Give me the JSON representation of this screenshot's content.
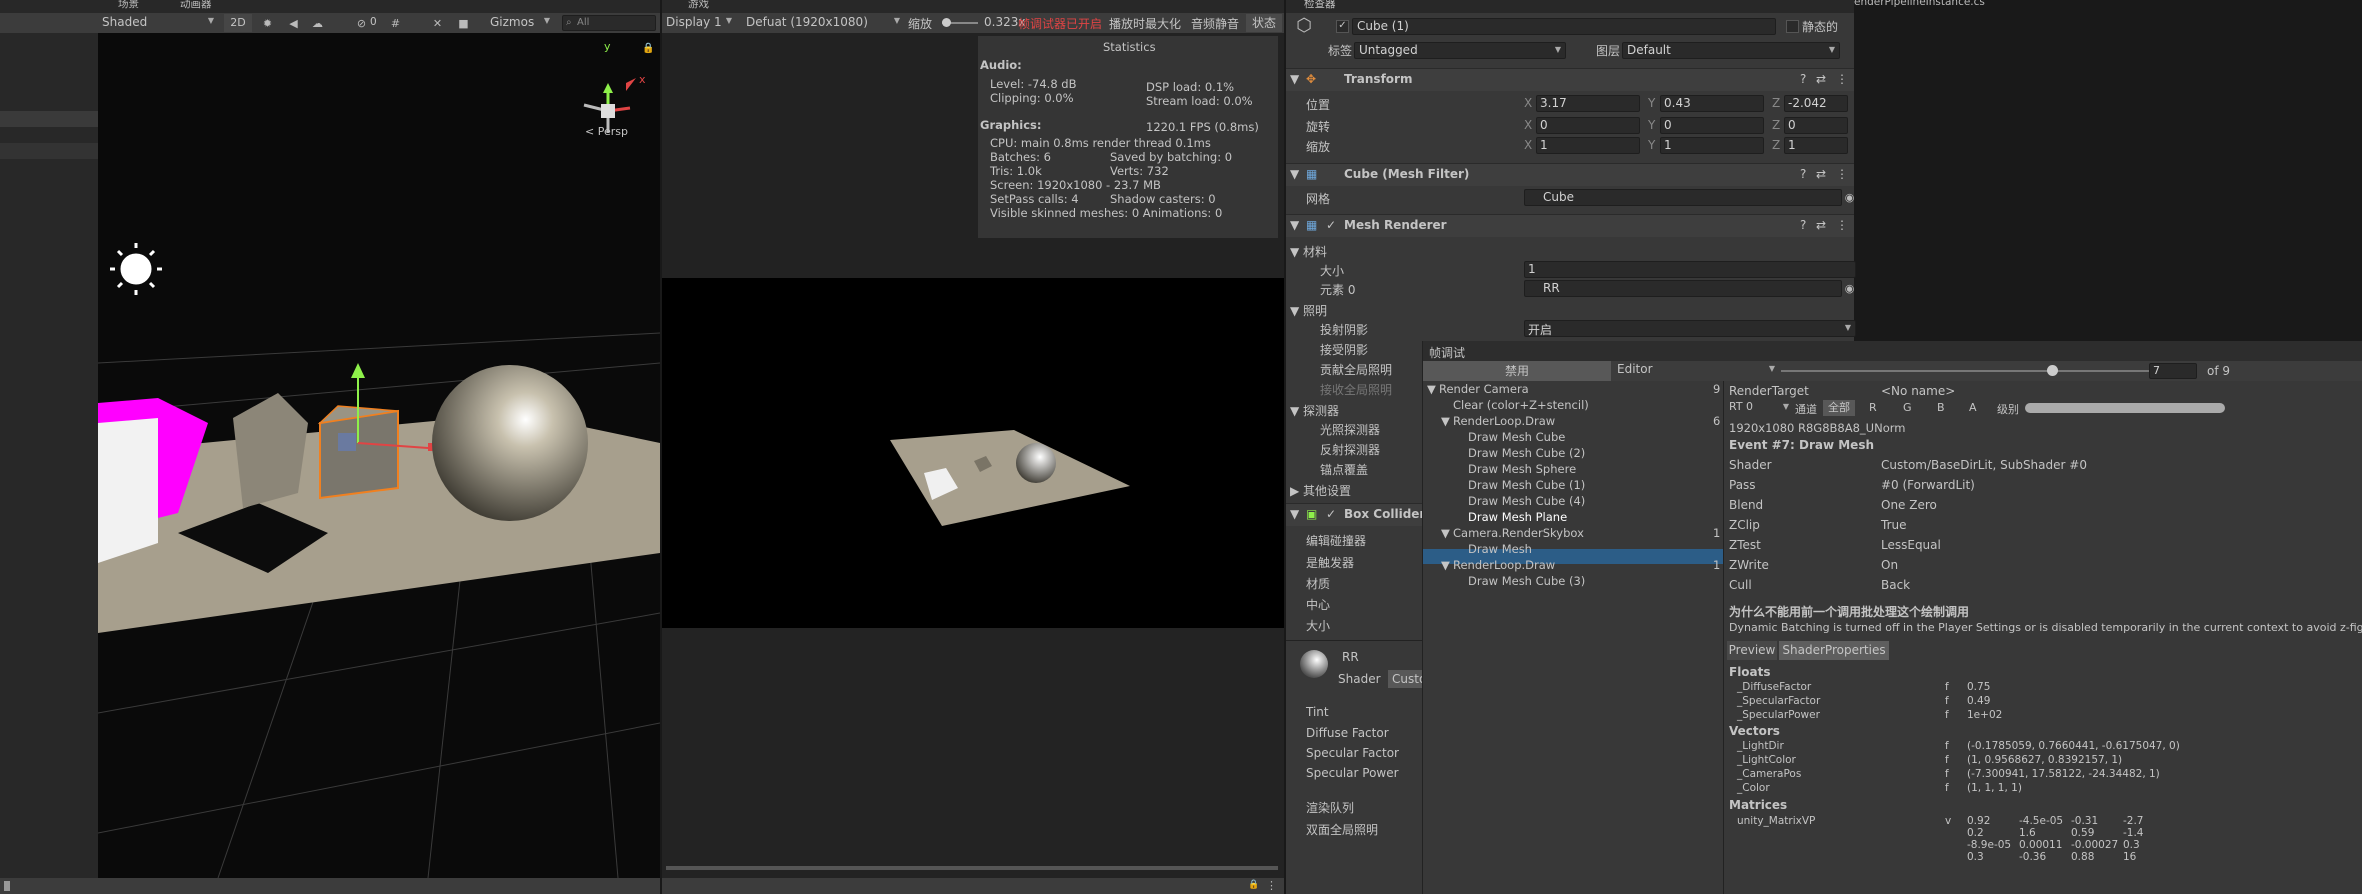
{
  "scene": {
    "tab": "场景",
    "tab2": "动画器",
    "shading": "Shaded",
    "mode2d": "2D",
    "fx_count": "0",
    "gizmos": "Gizmos",
    "search_placeholder": "All",
    "persp": "< Persp",
    "axis_x": "x",
    "axis_y": "y"
  },
  "game": {
    "tab": "游戏",
    "display": "Display 1",
    "resolution": "Defuat (1920x1080)",
    "scale_label": "缩放",
    "scale_value": "0.323x",
    "frame_debug_on": "帧调试器已开启",
    "maximize": "播放时最大化",
    "mute": "音频静音",
    "stats": "状态"
  },
  "stats": {
    "title": "Statistics",
    "audio_h": "Audio:",
    "level": "Level: -74.8 dB",
    "clipping": "Clipping: 0.0%",
    "dsp": "DSP load: 0.1%",
    "stream": "Stream load: 0.0%",
    "graphics_h": "Graphics:",
    "fps": "1220.1 FPS (0.8ms)",
    "cpu": "CPU: main 0.8ms  render thread 0.1ms",
    "batches": "Batches: 6",
    "saved": "Saved by batching: 0",
    "tris": "Tris: 1.0k",
    "verts": "Verts: 732",
    "screen": "Screen: 1920x1080 - 23.7 MB",
    "setpass": "SetPass calls: 4",
    "shadow": "Shadow casters: 0",
    "skinned": "Visible skinned meshes: 0  Animations: 0"
  },
  "inspector": {
    "tab": "检查器",
    "script_tab": "enderPipelineInstance.cs",
    "object_name": "Cube (1)",
    "static": "静态的",
    "tag_label": "标签",
    "tag": "Untagged",
    "layer_label": "图层",
    "layer": "Default",
    "transform": "Transform",
    "pos_label": "位置",
    "rot_label": "旋转",
    "scale_label": "缩放",
    "px": "3.17",
    "py": "0.43",
    "pz": "-2.042",
    "rx": "0",
    "ry": "0",
    "rz": "0",
    "sx": "1",
    "sy": "1",
    "sz": "1",
    "ax": "X",
    "ay": "Y",
    "az": "Z",
    "mesh_filter": "Cube (Mesh Filter)",
    "mesh_label": "网格",
    "mesh": "Cube",
    "mesh_renderer": "Mesh Renderer",
    "materials": "材料",
    "size_label": "大小",
    "size": "1",
    "element0_label": "元素 0",
    "element0": "RR",
    "lighting": "照明",
    "cast_shadows": "投射阴影",
    "cast_value": "开启",
    "receive_shadows": "接受阴影",
    "contribute_gi": "贡献全局照明",
    "receive_gi": "接收全局照明",
    "probes": "探测器",
    "light_probes": "光照探测器",
    "reflection_probes": "反射探测器",
    "anchor": "锚点覆盖",
    "other": "其他设置",
    "box_collider": "Box Collider",
    "edit_collider": "编辑碰撞器",
    "is_trigger": "是触发器",
    "material": "材质",
    "center": "中心",
    "bsize": "大小",
    "mat_name": "RR",
    "shader_label": "Shader",
    "shader_value": "Custo",
    "tint": "Tint",
    "diffuse": "Diffuse Factor",
    "specular": "Specular Factor",
    "specpow": "Specular Power",
    "render_queue": "渲染队列",
    "double_gi": "双面全局照明"
  },
  "frame_debugger": {
    "tab": "帧调试",
    "disable": "禁用",
    "target": "Editor",
    "current": "7",
    "of": "of 9",
    "tree": [
      {
        "label": "Render Camera",
        "count": "9"
      },
      {
        "label": "Clear (color+Z+stencil)",
        "count": ""
      },
      {
        "label": "RenderLoop.Draw",
        "count": "6"
      },
      {
        "label": "Draw Mesh Cube",
        "count": ""
      },
      {
        "label": "Draw Mesh Cube (2)",
        "count": ""
      },
      {
        "label": "Draw Mesh Sphere",
        "count": ""
      },
      {
        "label": "Draw Mesh Cube (1)",
        "count": ""
      },
      {
        "label": "Draw Mesh Cube (4)",
        "count": ""
      },
      {
        "label": "Draw Mesh Plane",
        "count": ""
      },
      {
        "label": "Camera.RenderSkybox",
        "count": "1"
      },
      {
        "label": "Draw Mesh",
        "count": ""
      },
      {
        "label": "RenderLoop.Draw",
        "count": "1"
      },
      {
        "label": "Draw Mesh Cube (3)",
        "count": ""
      }
    ],
    "render_target_label": "RenderTarget",
    "render_target": "<No name>",
    "rt": "RT 0",
    "channels": "通道",
    "all": "全部",
    "r": "R",
    "g": "G",
    "b": "B",
    "a": "A",
    "levels": "级别",
    "format": "1920x1080 R8G8B8A8_UNorm",
    "event": "Event #7: Draw Mesh",
    "props": [
      {
        "k": "Shader",
        "v": "Custom/BaseDirLit, SubShader #0"
      },
      {
        "k": "Pass",
        "v": "#0 (ForwardLit)"
      },
      {
        "k": "Blend",
        "v": "One Zero"
      },
      {
        "k": "ZClip",
        "v": "True"
      },
      {
        "k": "ZTest",
        "v": "LessEqual"
      },
      {
        "k": "ZWrite",
        "v": "On"
      },
      {
        "k": "Cull",
        "v": "Back"
      }
    ],
    "why_title": "为什么不能用前一个调用批处理这个绘制调用",
    "why_text": "Dynamic Batching is turned off in the Player Settings or is disabled temporarily in the current context to avoid z-fighting.",
    "preview": "Preview",
    "shader_props": "ShaderProperties",
    "floats_h": "Floats",
    "floats": [
      {
        "n": "_DiffuseFactor",
        "t": "f",
        "v": "0.75"
      },
      {
        "n": "_SpecularFactor",
        "t": "f",
        "v": "0.49"
      },
      {
        "n": "_SpecularPower",
        "t": "f",
        "v": "1e+02"
      }
    ],
    "vectors_h": "Vectors",
    "vectors": [
      {
        "n": "_LightDir",
        "t": "f",
        "v": "(-0.1785059, 0.7660441, -0.6175047, 0)"
      },
      {
        "n": "_LightColor",
        "t": "f",
        "v": "(1, 0.9568627, 0.8392157, 1)"
      },
      {
        "n": "_CameraPos",
        "t": "f",
        "v": "(-7.300941, 17.58122, -24.34482, 1)"
      },
      {
        "n": "_Color",
        "t": "f",
        "v": "(1, 1, 1, 1)"
      }
    ],
    "matrices_h": "Matrices",
    "matrix_name": "unity_MatrixVP",
    "matrix_type": "v",
    "matrix": [
      [
        "0.92",
        "-4.5e-05",
        "-0.31",
        "-2.7"
      ],
      [
        "0.2",
        "1.6",
        "0.59",
        "-1.4"
      ],
      [
        "-8.9e-05",
        "0.00011",
        "-0.00027",
        "0.3"
      ],
      [
        "0.3",
        "-0.36",
        "0.88",
        "16"
      ]
    ]
  },
  "colors": {
    "selection": "#2c5d87",
    "accent_red": "#e04444",
    "magenta": "#ff00ff",
    "orange": "#f08020"
  }
}
